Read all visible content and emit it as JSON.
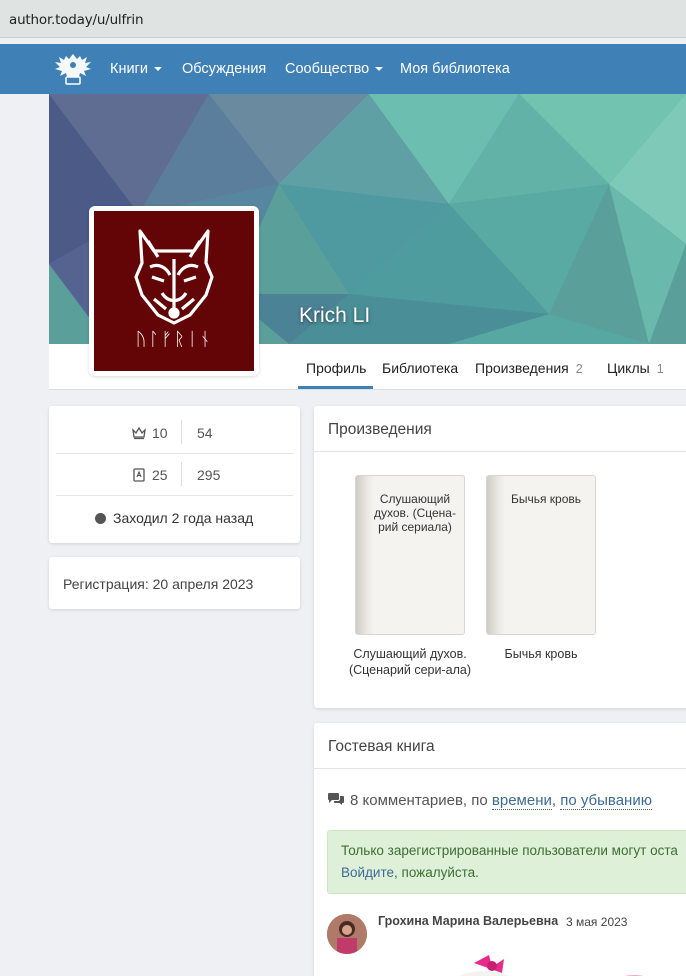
{
  "browser": {
    "url": "author.today/u/ulfrin"
  },
  "nav": {
    "items": [
      {
        "label": "Книги",
        "dropdown": true
      },
      {
        "label": "Обсуждения",
        "dropdown": false
      },
      {
        "label": "Сообщество",
        "dropdown": true
      },
      {
        "label": "Моя библиотека",
        "dropdown": false
      }
    ]
  },
  "profile": {
    "name": "Krich LI",
    "avatar_runes": "ᚢᛚᚠᚱᛁᚾ"
  },
  "tabs": [
    {
      "label": "Профиль",
      "count": "",
      "active": true
    },
    {
      "label": "Библиотека",
      "count": ""
    },
    {
      "label": "Произведения",
      "count": "2"
    },
    {
      "label": "Циклы",
      "count": "1"
    }
  ],
  "stats": {
    "rows": [
      {
        "icon": "crown-icon",
        "value1": "10",
        "value2": "54"
      },
      {
        "icon": "book-icon",
        "value1": "25",
        "value2": "295"
      }
    ],
    "last_seen": "Заходил 2 года назад"
  },
  "registration": "Регистрация: 20 апреля 2023",
  "works": {
    "title": "Произведения",
    "books": [
      {
        "cover_title": "Слушающий духов. (Сцена-рий сериала)",
        "caption": "Слушающий духов. (Сценарий сери-ала)"
      },
      {
        "cover_title": "Бычья кровь",
        "caption": "Бычья кровь"
      }
    ]
  },
  "guestbook": {
    "title": "Гостевая книга",
    "comments_count": "8 комментариев, по",
    "sort_by": "времени",
    "sort_order": "по убыванию",
    "alert_line1": "Только зарегистрированные пользователи могут оста",
    "alert_login": "Войдите",
    "alert_line2_rest": ", пожалуйста.",
    "comment": {
      "author": "Грохина Марина Валерьевна",
      "date": "3 мая 2023"
    }
  },
  "colors": {
    "navbar": "#3f80b6",
    "avatar_bg": "#630406",
    "alert_bg": "#dff0d8"
  }
}
